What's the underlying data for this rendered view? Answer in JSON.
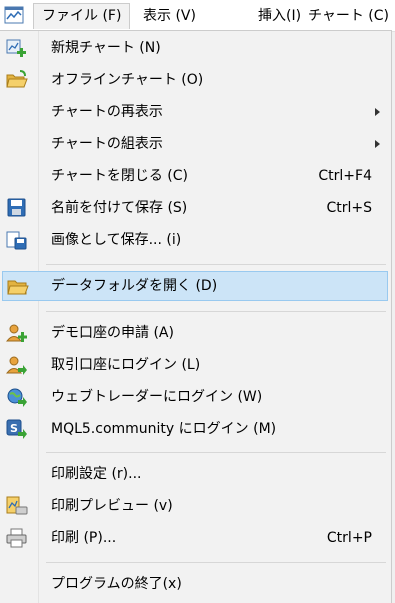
{
  "menubar": {
    "items": [
      {
        "label": "ファイル (F)"
      },
      {
        "label": "表示 (V)"
      },
      {
        "label": "挿入(I)"
      },
      {
        "label": "チャート (C)"
      }
    ]
  },
  "menu": {
    "items": [
      {
        "label": "新規チャート (N)",
        "icon": "new-chart-icon"
      },
      {
        "label": "オフラインチャート (O)",
        "icon": "open-folder-icon"
      },
      {
        "label": "チャートの再表示",
        "submenu": true
      },
      {
        "label": "チャートの組表示",
        "submenu": true
      },
      {
        "label": "チャートを閉じる (C)",
        "shortcut": "Ctrl+F4"
      },
      {
        "label": "名前を付けて保存 (S)",
        "shortcut": "Ctrl+S",
        "icon": "floppy-disk-icon"
      },
      {
        "label": "画像として保存... (i)",
        "icon": "save-image-icon"
      },
      {
        "label": "データフォルダを開く (D)",
        "icon": "folder-icon",
        "highlighted": true
      },
      {
        "label": "デモ口座の申請 (A)",
        "icon": "user-add-icon"
      },
      {
        "label": "取引口座にログイン (L)",
        "icon": "user-login-icon"
      },
      {
        "label": "ウェブトレーダーにログイン (W)",
        "icon": "globe-login-icon"
      },
      {
        "label": "MQL5.community にログイン (M)",
        "icon": "mql5-icon"
      },
      {
        "label": "印刷設定 (r)..."
      },
      {
        "label": "印刷プレビュー (v)",
        "icon": "print-preview-icon"
      },
      {
        "label": "印刷 (P)...",
        "shortcut": "Ctrl+P",
        "icon": "printer-icon"
      },
      {
        "label": "プログラムの終了(x)"
      }
    ]
  },
  "colors": {
    "highlight_bg": "#cce4f7",
    "highlight_border": "#99c9ef",
    "menu_bg": "#f2f2f2"
  }
}
